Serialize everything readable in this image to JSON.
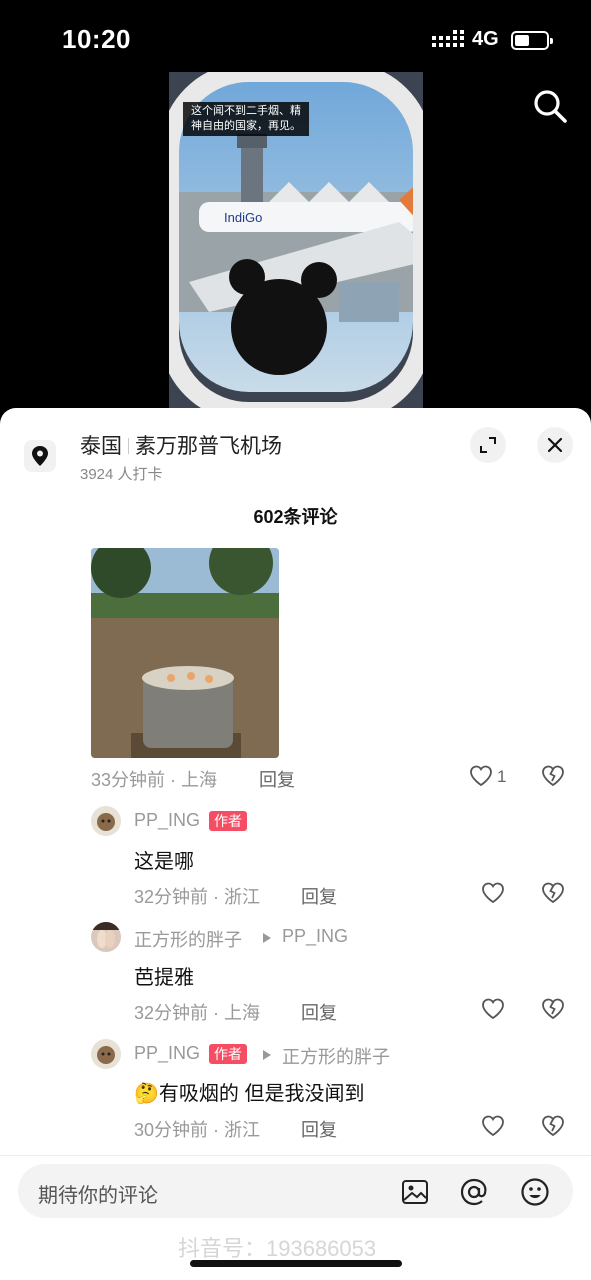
{
  "status_bar": {
    "time": "10:20",
    "network": "4G",
    "battery_level": 0.45
  },
  "video": {
    "caption": "这个闻不到二手烟、精神自由的国家，再见。"
  },
  "location": {
    "country": "泰国",
    "place": "素万那普飞机场",
    "checkins": "3924 人打卡"
  },
  "comments_header": "602条评论",
  "comment": {
    "meta": "33分钟前 · 上海",
    "reply_label": "回复",
    "likes": "1"
  },
  "replies": [
    {
      "user": "PP_ING",
      "author_tag": "作者",
      "reply_to": "",
      "text": "这是哪",
      "meta": "32分钟前 · 浙江",
      "reply_label": "回复"
    },
    {
      "user": "正方形的胖子",
      "author_tag": "",
      "reply_to": "PP_ING",
      "text": "芭提雅",
      "meta": "32分钟前 · 上海",
      "reply_label": "回复"
    },
    {
      "user": "PP_ING",
      "author_tag": "作者",
      "reply_to": "正方形的胖子",
      "emoji": "🤔",
      "text": "有吸烟的 但是我没闻到",
      "meta": "30分钟前 · 浙江",
      "reply_label": "回复"
    }
  ],
  "input": {
    "placeholder": "期待你的评论"
  },
  "watermark": "抖音号：193686053",
  "colors": {
    "author_tag": "#f54e64",
    "sheet": "#ffffff",
    "input_bg": "#f3f3f3"
  }
}
